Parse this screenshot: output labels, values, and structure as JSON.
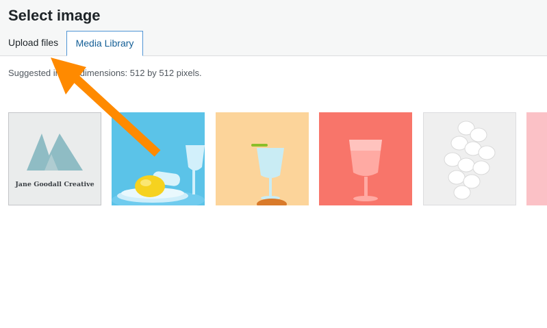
{
  "modal": {
    "title": "Select image",
    "tabs": [
      {
        "label": "Upload files",
        "active": false
      },
      {
        "label": "Media Library",
        "active": true
      }
    ],
    "hint": "Suggested image dimensions: 512 by 512 pixels."
  },
  "library": {
    "items": [
      {
        "name": "logo",
        "logo_text": "Jane Goodall Creative",
        "bg": "#eaecec",
        "mark": "#8fbcc4"
      },
      {
        "name": "lemon",
        "bg": "#5bc3e8"
      },
      {
        "name": "glass-peach",
        "bg": "#fcd49a"
      },
      {
        "name": "glass-coral",
        "bg": "#f8756a"
      },
      {
        "name": "eggs",
        "bg": "#efefef"
      },
      {
        "name": "pink-partial",
        "bg": "#fbc1c6"
      }
    ]
  },
  "annotation": {
    "color": "#ff8a00"
  }
}
